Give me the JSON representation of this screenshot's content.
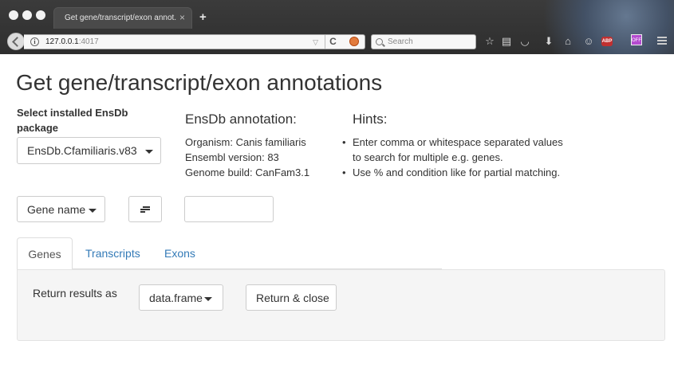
{
  "browser": {
    "tab_title": "Get gene/transcript/exon annot...",
    "tab_close": "×",
    "new_tab": "+",
    "url_host": "127.0.0.1",
    "url_port": ":4017",
    "search_placeholder": "Search",
    "abp_label": "ABP",
    "off_label": "OFF",
    "icons": [
      "back-arrow-icon",
      "info-icon",
      "reload-icon",
      "search-engine-icon",
      "search-icon",
      "star-icon",
      "reading-list-icon",
      "pocket-icon",
      "download-icon",
      "home-icon",
      "smiley-icon",
      "adblock-icon",
      "off-badge-icon",
      "menu-icon"
    ]
  },
  "page": {
    "title": "Get gene/transcript/exon annotations",
    "select_label": "Select installed EnsDb package",
    "selected_package": "EnsDb.Cfamiliaris.v83",
    "annotation": {
      "heading": "EnsDb annotation:",
      "organism": "Organism: Canis familiaris",
      "ensembl_version": "Ensembl version: 83",
      "genome_build": "Genome build: CanFam3.1"
    },
    "hints": {
      "heading": "Hints:",
      "items": [
        "Enter comma or whitespace separated values to search for multiple e.g. genes.",
        "Use % and condition like for partial matching."
      ]
    },
    "filter_field": "Gene name",
    "search_value": "",
    "tabs": [
      {
        "label": "Genes",
        "active": true
      },
      {
        "label": "Transcripts",
        "active": false
      },
      {
        "label": "Exons",
        "active": false
      }
    ],
    "return_label": "Return results as",
    "return_format": "data.frame",
    "return_close": "Return & close"
  },
  "colors": {
    "link": "#337ab7",
    "panel_bg": "#f5f5f5",
    "chrome_bg": "#2e2e2e"
  }
}
